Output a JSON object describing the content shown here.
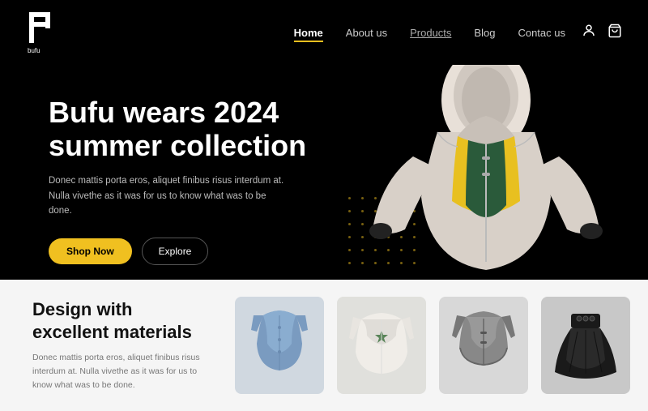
{
  "header": {
    "logo_text": "bufu",
    "nav": {
      "items": [
        {
          "label": "Home",
          "active": true
        },
        {
          "label": "About us",
          "active": false
        },
        {
          "label": "Products",
          "active": false,
          "underlined": true
        },
        {
          "label": "Blog",
          "active": false
        },
        {
          "label": "Contac us",
          "active": false
        }
      ]
    }
  },
  "hero": {
    "title_line1": "Bufu wears 2024",
    "title_line2": "summer collection",
    "description": "Donec mattis porta eros, aliquet finibus risus interdum at. Nulla vivethe as it was for us to know what was to be done.",
    "btn_shop": "Shop Now",
    "btn_explore": "Explore"
  },
  "bottom": {
    "title_line1": "Design with",
    "title_line2": "excellent materials",
    "description": "Donec mattis porta eros, aliquet finibus risus interdum at. Nulla vivethe as it was for us to know what was to be done.",
    "products": [
      {
        "id": 1,
        "alt": "Denim vest"
      },
      {
        "id": 2,
        "alt": "White jacket"
      },
      {
        "id": 3,
        "alt": "Grey crop jacket"
      },
      {
        "id": 4,
        "alt": "Black skirt"
      }
    ]
  }
}
